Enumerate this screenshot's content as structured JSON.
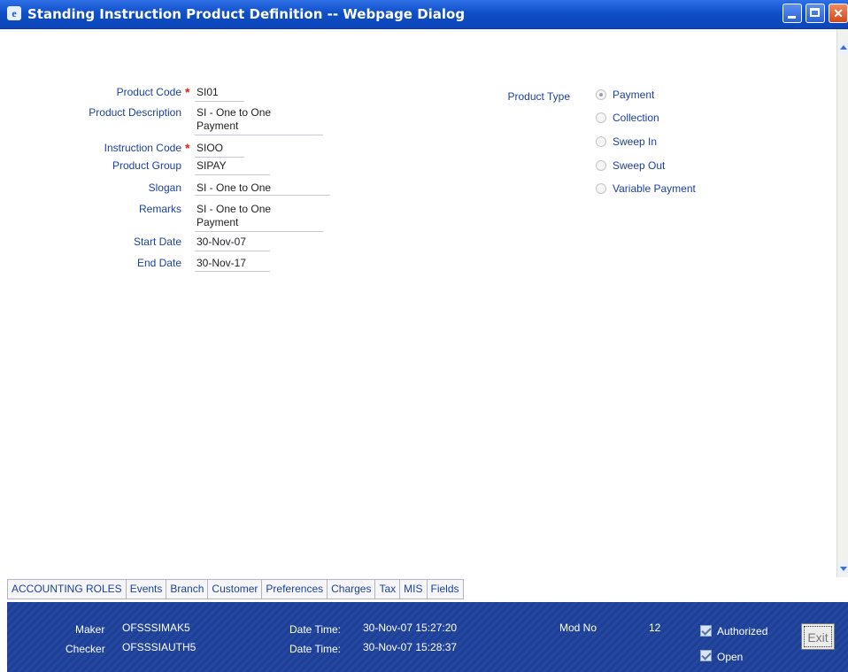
{
  "window": {
    "title": "Standing Instruction Product Definition -- Webpage Dialog",
    "icon": "ie-icon"
  },
  "form": {
    "product_code": {
      "label": "Product Code",
      "value": "SI01",
      "required": true
    },
    "product_description": {
      "label": "Product Description",
      "value_line1": "SI - One to One",
      "value_line2": "Payment"
    },
    "instruction_code": {
      "label": "Instruction Code",
      "value": "SIOO",
      "required": true
    },
    "product_group": {
      "label": "Product Group",
      "value": "SIPAY"
    },
    "slogan": {
      "label": "Slogan",
      "value": "SI - One to One"
    },
    "remarks": {
      "label": "Remarks",
      "value_line1": "SI - One to One",
      "value_line2": "Payment"
    },
    "start_date": {
      "label": "Start Date",
      "value": "30-Nov-07"
    },
    "end_date": {
      "label": "End Date",
      "value": "30-Nov-17"
    }
  },
  "product_type": {
    "label": "Product Type",
    "options": [
      "Payment",
      "Collection",
      "Sweep In",
      "Sweep Out",
      "Variable Payment"
    ],
    "selected": "Payment"
  },
  "tabs": [
    "ACCOUNTING ROLES",
    "Events",
    "Branch",
    "Customer",
    "Preferences",
    "Charges",
    "Tax",
    "MIS",
    "Fields"
  ],
  "footer": {
    "maker_label": "Maker",
    "maker_value": "OFSSSIMAK5",
    "checker_label": "Checker",
    "checker_value": "OFSSSIAUTH5",
    "datetime_label": "Date Time:",
    "maker_datetime": "30-Nov-07 15:27:20",
    "checker_datetime": "30-Nov-07 15:28:37",
    "mod_no_label": "Mod No",
    "mod_no_value": "12",
    "authorized_label": "Authorized",
    "open_label": "Open",
    "exit_label": "Exit"
  },
  "colors": {
    "titlebar": "#0f4fc8",
    "label": "#1c3fa0",
    "required": "#e02020",
    "footer": "#1e3f95"
  }
}
